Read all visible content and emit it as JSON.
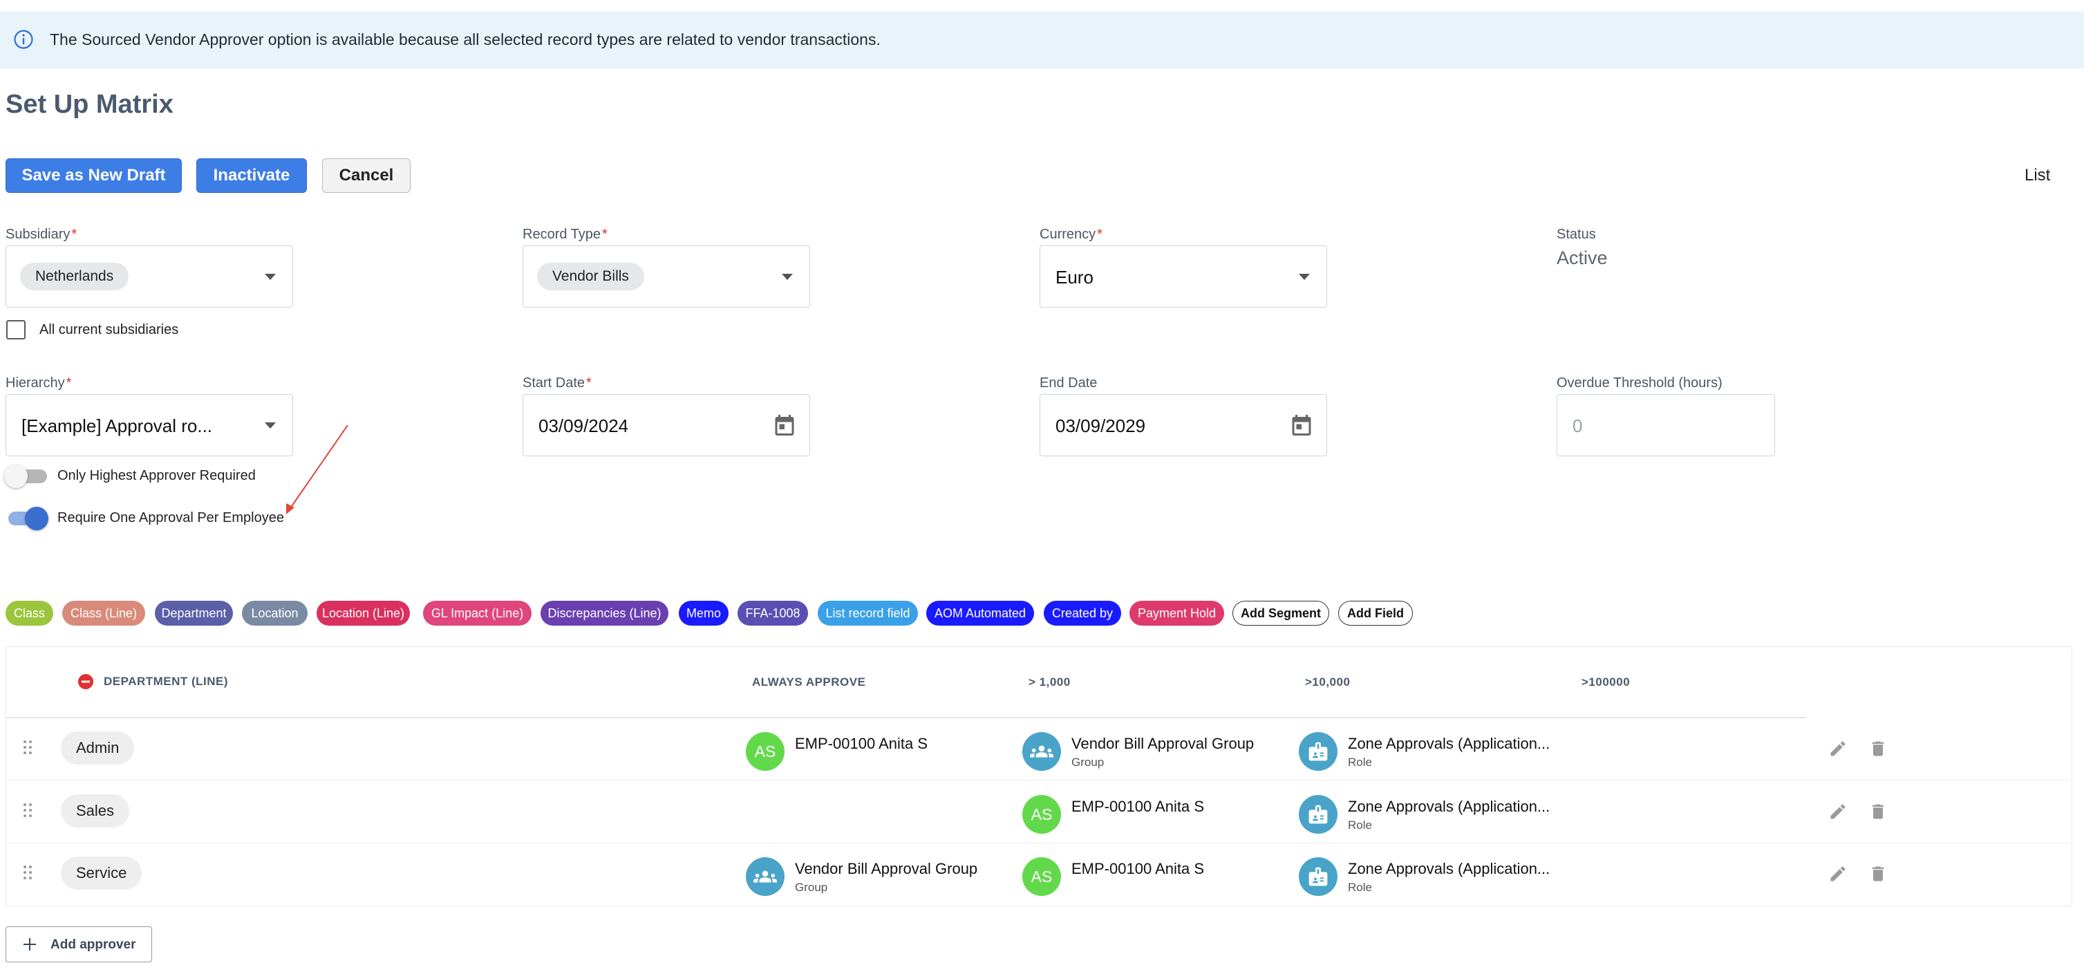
{
  "banner": {
    "text": "The Sourced Vendor Approver option is available because all selected record types are related to vendor transactions.",
    "icon": "info-icon"
  },
  "page": {
    "title": "Set Up Matrix",
    "list_link": "List"
  },
  "toolbar": {
    "save_draft": "Save as New Draft",
    "inactivate": "Inactivate",
    "cancel": "Cancel"
  },
  "form": {
    "subsidiary": {
      "label": "Subsidiary",
      "required": "*",
      "value": "Netherlands"
    },
    "all_subsidiaries": {
      "label": "All current subsidiaries",
      "checked": false
    },
    "record_type": {
      "label": "Record Type",
      "required": "*",
      "value": "Vendor Bills"
    },
    "currency": {
      "label": "Currency",
      "required": "*",
      "value": "Euro"
    },
    "status": {
      "label": "Status",
      "value": "Active"
    },
    "hierarchy": {
      "label": "Hierarchy",
      "required": "*",
      "value": "[Example] Approval ro..."
    },
    "start_date": {
      "label": "Start Date",
      "required": "*",
      "value": "03/09/2024"
    },
    "end_date": {
      "label": "End Date",
      "value": "03/09/2029"
    },
    "overdue": {
      "label": "Overdue Threshold (hours)",
      "placeholder": "0"
    },
    "only_highest": {
      "label": "Only Highest Approver Required",
      "on": false
    },
    "one_per_employee": {
      "label": "Require One Approval Per Employee",
      "on": true
    }
  },
  "segments": [
    {
      "label": "Class",
      "color": "#9bc53d"
    },
    {
      "label": "Class (Line)",
      "color": "#d98a7a"
    },
    {
      "label": "Department",
      "color": "#5b5fa8"
    },
    {
      "label": "Location",
      "color": "#7b8aa3"
    },
    {
      "label": "Location (Line)",
      "color": "#d9305e"
    },
    {
      "label": "GL Impact (Line)",
      "color": "#e0457b"
    },
    {
      "label": "Discrepancies (Line)",
      "color": "#6a3fb0"
    },
    {
      "label": "Memo",
      "color": "#1a1aff"
    },
    {
      "label": "FFA-1008",
      "color": "#5b4fb3"
    },
    {
      "label": "List record field",
      "color": "#3aa0e8"
    },
    {
      "label": "AOM Automated",
      "color": "#1a1aff"
    },
    {
      "label": "Created by",
      "color": "#1a1aff"
    },
    {
      "label": "Payment Hold",
      "color": "#de3a6e"
    },
    {
      "label": "Add Segment",
      "color": "#ffffff"
    },
    {
      "label": "Add Field",
      "color": "#ffffff"
    }
  ],
  "table": {
    "headers": [
      "DEPARTMENT (LINE)",
      "ALWAYS APPROVE",
      "> 1,000",
      ">10,000",
      ">100000"
    ],
    "rows": [
      {
        "department": "Admin",
        "always": {
          "initials": "AS",
          "name": "EMP-00100 Anita S",
          "sub": ""
        },
        "gt1000": {
          "icon": "group-icon",
          "name": "Vendor Bill Approval Group",
          "sub": "Group"
        },
        "gt10000": {
          "icon": "role-icon",
          "name": "Zone Approvals (Application...",
          "sub": "Role"
        }
      },
      {
        "department": "Sales",
        "gt1000": {
          "initials": "AS",
          "name": "EMP-00100 Anita S",
          "sub": ""
        },
        "gt10000": {
          "icon": "role-icon",
          "name": "Zone Approvals (Application...",
          "sub": "Role"
        }
      },
      {
        "department": "Service",
        "always": {
          "icon": "group-icon",
          "name": "Vendor Bill Approval Group",
          "sub": "Group"
        },
        "gt1000": {
          "initials": "AS",
          "name": "EMP-00100 Anita S",
          "sub": ""
        },
        "gt10000": {
          "icon": "role-icon",
          "name": "Zone Approvals (Application...",
          "sub": "Role"
        }
      }
    ]
  },
  "add_approver": "Add approver",
  "colors": {
    "primary": "#3d7de6",
    "banner_bg": "#e8f4fa",
    "avatar_green": "#62d94a",
    "avatar_blue": "#4aa3c9",
    "toggle_on": "#3a6fd0",
    "remove_red": "#e03030"
  }
}
